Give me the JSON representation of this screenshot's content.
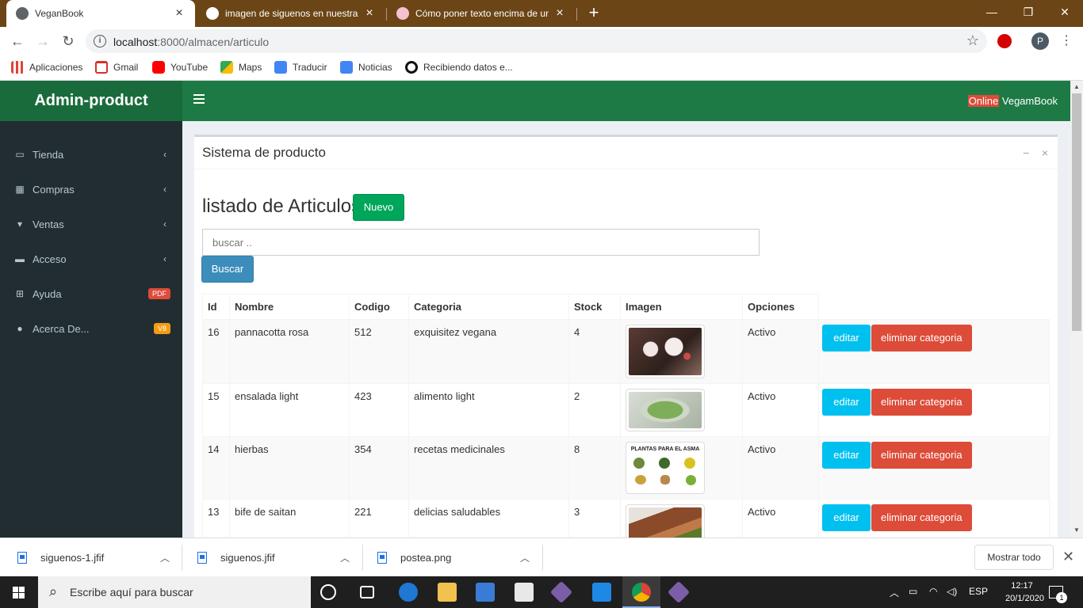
{
  "browser": {
    "tabs": [
      {
        "title": "VeganBook",
        "active": true,
        "favicon_color": "#5f6368"
      },
      {
        "title": "imagen de siguenos en nuestra re",
        "active": false,
        "favicon_color": "#ffffff"
      },
      {
        "title": "Cómo poner texto encima de una",
        "active": false,
        "favicon_color": "#f5c0d0"
      }
    ],
    "new_tab_label": "+",
    "window_controls": {
      "minimize": "—",
      "maximize": "❐",
      "close": "✕"
    },
    "url_host": "localhost",
    "url_path": ":8000/almacen/articulo",
    "bookmarks": [
      {
        "label": "Aplicaciones",
        "icon": "apps-grid-icon",
        "color": "#e34133"
      },
      {
        "label": "Gmail",
        "icon": "gmail-icon",
        "color": "#d93025"
      },
      {
        "label": "YouTube",
        "icon": "youtube-icon",
        "color": "#ff0000"
      },
      {
        "label": "Maps",
        "icon": "maps-icon",
        "color": "#34a853"
      },
      {
        "label": "Traducir",
        "icon": "translate-icon",
        "color": "#4285f4"
      },
      {
        "label": "Noticias",
        "icon": "news-icon",
        "color": "#4285f4"
      },
      {
        "label": "Recibiendo datos e...",
        "icon": "loading-icon",
        "color": "#111111"
      }
    ],
    "profile_initial": "P"
  },
  "app": {
    "brand": "Admin-product",
    "status_badge": "Online",
    "user_name": "VegamBook",
    "colors": {
      "header": "#1e7a44",
      "logo_bg": "#1a6b3c",
      "sidebar": "#222d32"
    },
    "sidebar": [
      {
        "label": "Tienda",
        "icon": "laptop-icon",
        "chevron": "‹"
      },
      {
        "label": "Compras",
        "icon": "grid-icon",
        "chevron": "‹"
      },
      {
        "label": "Ventas",
        "icon": "cart-icon",
        "chevron": "‹"
      },
      {
        "label": "Acceso",
        "icon": "folder-icon",
        "chevron": "‹"
      },
      {
        "label": "Ayuda",
        "icon": "plus-square-icon",
        "badge": "PDF",
        "badge_color": "#dd4b39"
      },
      {
        "label": "Acerca De...",
        "icon": "info-icon",
        "badge": "V8",
        "badge_color": "#f39c12"
      }
    ]
  },
  "box": {
    "title": "Sistema de producto",
    "collapse": "−",
    "close": "×"
  },
  "listing": {
    "title": "listado de Articulos",
    "new_button": "Nuevo",
    "search_placeholder": "buscar ..",
    "search_button": "Buscar",
    "columns": [
      "Id",
      "Nombre",
      "Codigo",
      "Categoria",
      "Stock",
      "Imagen",
      "Opciones"
    ],
    "rows": [
      {
        "id": "16",
        "nombre": "pannacotta rosa",
        "codigo": "512",
        "categoria": "exquisitez vegana",
        "stock": "4",
        "estado": "Activo",
        "image": "dessert-image"
      },
      {
        "id": "15",
        "nombre": "ensalada light",
        "codigo": "423",
        "categoria": "alimento light",
        "stock": "2",
        "estado": "Activo",
        "image": "salad-image"
      },
      {
        "id": "14",
        "nombre": "hierbas",
        "codigo": "354",
        "categoria": "recetas medicinales",
        "stock": "8",
        "estado": "Activo",
        "image": "plants-poster-image",
        "image_caption": "PLANTAS PARA EL ASMA"
      },
      {
        "id": "13",
        "nombre": "bife de saitan",
        "codigo": "221",
        "categoria": "delicias saludables",
        "stock": "3",
        "estado": "Activo",
        "image": "seitan-image"
      }
    ],
    "edit_label": "editar",
    "delete_label": "eliminar categoria"
  },
  "downloads": {
    "files": [
      "siguenos-1.jfif",
      "siguenos.jfif",
      "postea.png"
    ],
    "show_all": "Mostrar todo"
  },
  "taskbar": {
    "search_text": "Escribe aquí para buscar",
    "language": "ESP",
    "time": "12:17",
    "date": "20/1/2020",
    "notifications": "1"
  }
}
